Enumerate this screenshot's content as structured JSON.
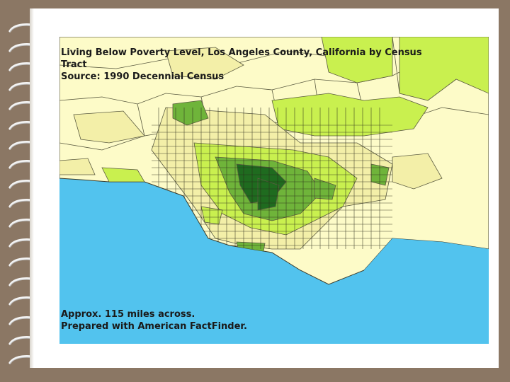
{
  "map": {
    "title_line1": "Living Below Poverty Level, Los Angeles County, California by Census",
    "title_line2": "Tract",
    "source": "Source: 1990 Decennial Census",
    "footer_line1": "Approx. 115 miles across.",
    "footer_line2": "Prepared with American FactFinder."
  },
  "colors": {
    "page_background": "#8b7764",
    "ocean": "#52c3ee",
    "land_lightest": "#fdfbc8",
    "land_light": "#f3efa8",
    "land_lime": "#c9f04f",
    "land_green": "#6fb43a",
    "land_dark_green": "#1f6b1f"
  },
  "binding": {
    "icon": "spiral-ring-icon",
    "ring_count": 18
  }
}
